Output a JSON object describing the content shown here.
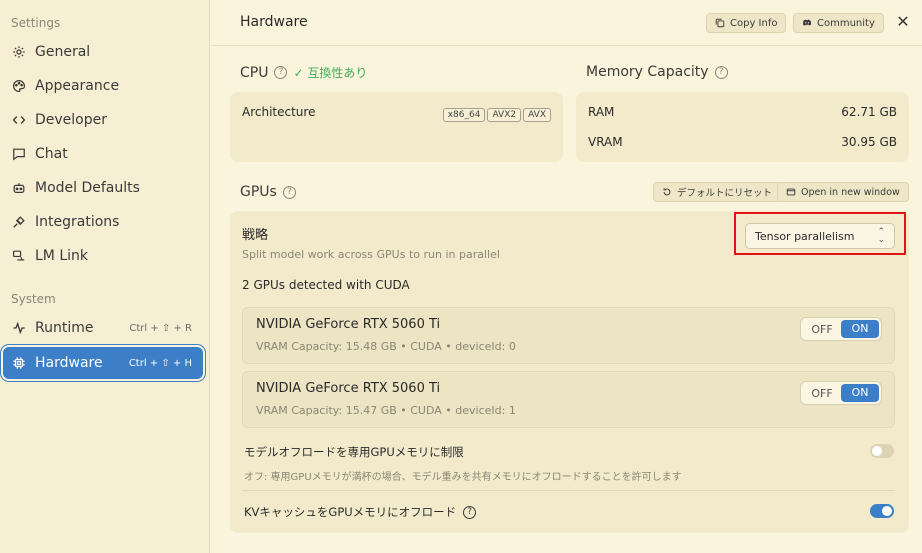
{
  "sidebar": {
    "settings_heading": "Settings",
    "system_heading": "System",
    "items": [
      {
        "label": "General",
        "icon": "gear-icon"
      },
      {
        "label": "Appearance",
        "icon": "palette-icon"
      },
      {
        "label": "Developer",
        "icon": "code-icon"
      },
      {
        "label": "Chat",
        "icon": "chat-icon"
      },
      {
        "label": "Model Defaults",
        "icon": "robot-icon"
      },
      {
        "label": "Integrations",
        "icon": "plug-icon"
      },
      {
        "label": "LM Link",
        "icon": "link-icon"
      }
    ],
    "system_items": [
      {
        "label": "Runtime",
        "icon": "activity-icon",
        "shortcut": "Ctrl + ⇧ + R"
      },
      {
        "label": "Hardware",
        "icon": "chip-icon",
        "shortcut": "Ctrl + ⇧ + H",
        "active": true
      }
    ]
  },
  "header": {
    "title": "Hardware",
    "copy_info": "Copy Info",
    "community": "Community",
    "close": "✕"
  },
  "cpu": {
    "label": "CPU",
    "compat": "✓ 互換性あり",
    "architecture_label": "Architecture",
    "tags": [
      "x86_64",
      "AVX2",
      "AVX"
    ]
  },
  "memory": {
    "label": "Memory Capacity",
    "ram_label": "RAM",
    "ram_value": "62.71 GB",
    "vram_label": "VRAM",
    "vram_value": "30.95 GB"
  },
  "gpus": {
    "label": "GPUs",
    "reset_button": "デフォルトにリセット",
    "open_window_button": "Open in new window",
    "strategy_label": "戦略",
    "strategy_desc": "Split model work across GPUs to run in parallel",
    "strategy_value": "Tensor parallelism",
    "detected": "2 GPUs detected with CUDA",
    "devices": [
      {
        "name": "NVIDIA GeForce RTX 5060 Ti",
        "detail": "VRAM Capacity: 15.48 GB • CUDA • deviceId: 0",
        "off": "OFF",
        "on": "ON"
      },
      {
        "name": "NVIDIA GeForce RTX 5060 Ti",
        "detail": "VRAM Capacity: 15.47 GB • CUDA • deviceId: 1",
        "off": "OFF",
        "on": "ON"
      }
    ],
    "offload_limit_label": "モデルオフロードを専用GPUメモリに制限",
    "offload_limit_desc": "オフ: 専用GPUメモリが満杯の場合、モデル重みを共有メモリにオフロードすることを許可します",
    "offload_limit_enabled": false,
    "kv_offload_label": "KVキャッシュをGPUメモリにオフロード",
    "kv_offload_enabled": true
  },
  "colors": {
    "accent": "#3c7fc8",
    "background": "#fbf4dc",
    "compat_green": "#3fae5a",
    "highlight_red": "#e3121a"
  }
}
